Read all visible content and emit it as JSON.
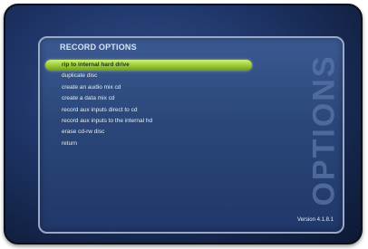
{
  "screen": {
    "title": "RECORD OPTIONS",
    "side_label": "OPTIONS",
    "version": "Version 4.1.8.1"
  },
  "menu": {
    "items": [
      {
        "label": "rip to internal hard drive",
        "selected": true
      },
      {
        "label": "duplicate disc",
        "selected": false
      },
      {
        "label": "create an audio mix cd",
        "selected": false
      },
      {
        "label": "create a data mix cd",
        "selected": false
      },
      {
        "label": "record aux inputs direct to cd",
        "selected": false
      },
      {
        "label": "record aux inputs to the internal hd",
        "selected": false
      },
      {
        "label": "erase cd-rw disc",
        "selected": false
      },
      {
        "label": "return",
        "selected": false
      }
    ]
  },
  "colors": {
    "highlight": "#9ccf39",
    "background": "#1f3568",
    "panel": "#2a4678"
  }
}
